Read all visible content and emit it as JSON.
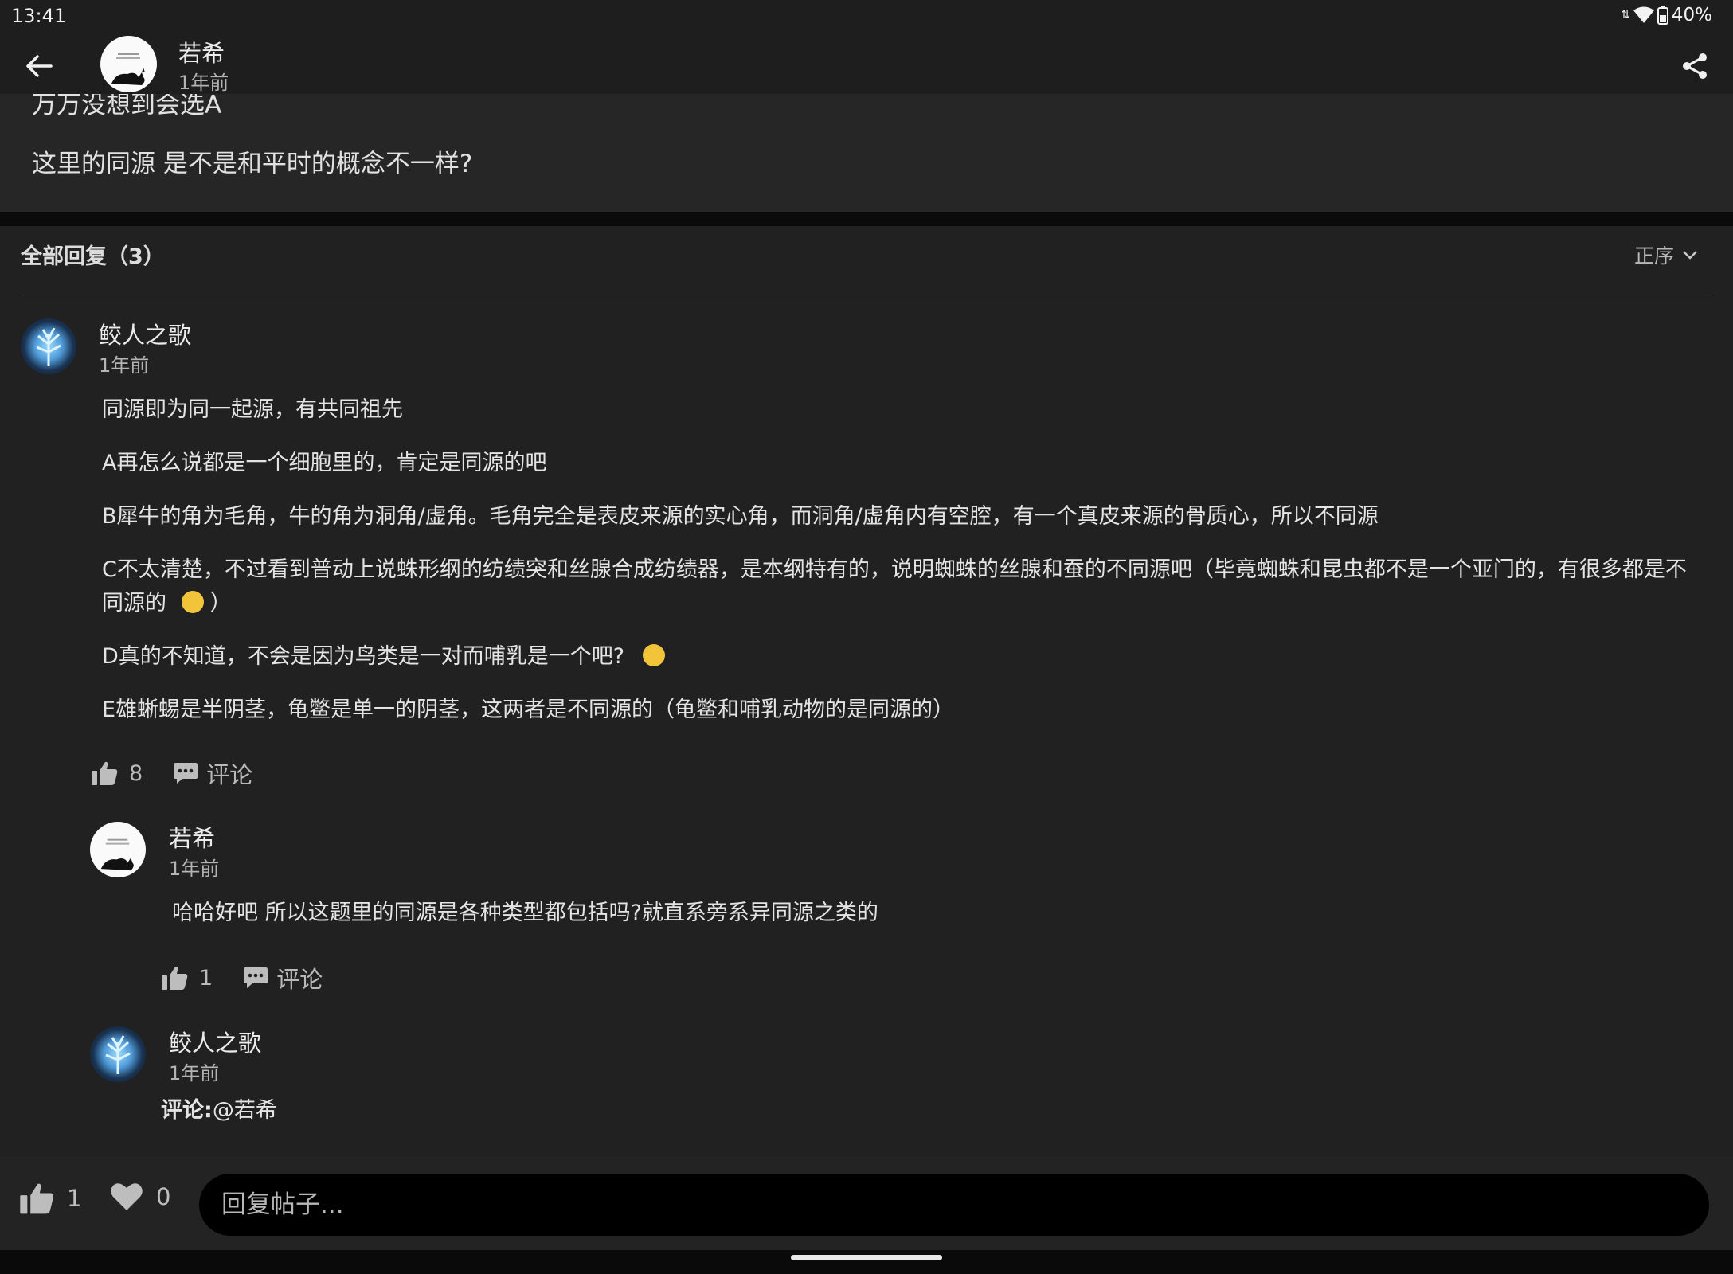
{
  "status_bar": {
    "time": "13:41",
    "battery": "40%"
  },
  "header": {
    "user": "若希",
    "time": "1年前"
  },
  "post": {
    "line1": "万万没想到会选A",
    "line2": "这里的同源 是不是和平时的概念不一样?"
  },
  "replies": {
    "title": "全部回复（3）",
    "sort_label": "正序",
    "items": [
      {
        "user": "鲛人之歌",
        "time": "1年前",
        "paragraphs": [
          "同源即为同一起源，有共同祖先",
          "A再怎么说都是一个细胞里的，肯定是同源的吧",
          "B犀牛的角为毛角，牛的角为洞角/虚角。毛角完全是表皮来源的实心角，而洞角/虚角内有空腔，有一个真皮来源的骨质心，所以不同源",
          "C不太清楚，不过看到普动上说蛛形纲的纺绩突和丝腺合成纺绩器，是本纲特有的，说明蜘蛛的丝腺和蚕的不同源吧（毕竟蜘蛛和昆虫都不是一个亚门的，有很多都是不",
          "同源的",
          "）",
          "D真的不知道，不会是因为鸟类是一对而哺乳是一个吧?",
          "E雄蜥蜴是半阴茎，龟鳖是单一的阴茎，这两者是不同源的（龟鳖和哺乳动物的是同源的）"
        ],
        "likes": "8",
        "comment_label": "评论"
      },
      {
        "user": "若希",
        "time": "1年前",
        "text": "哈哈好吧  所以这题里的同源是各种类型都包括吗?就直系旁系异同源之类的",
        "likes": "1",
        "comment_label": "评论"
      },
      {
        "user": "鲛人之歌",
        "time": "1年前",
        "prefix": "评论:",
        "mention": "@若希"
      }
    ]
  },
  "bottom_bar": {
    "likes": "1",
    "favorites": "0",
    "reply_placeholder": "回复帖子..."
  },
  "colors": {
    "background": "#212121",
    "header": "#1e1e1e",
    "input": "#000000",
    "text": "#e6e6e6"
  }
}
